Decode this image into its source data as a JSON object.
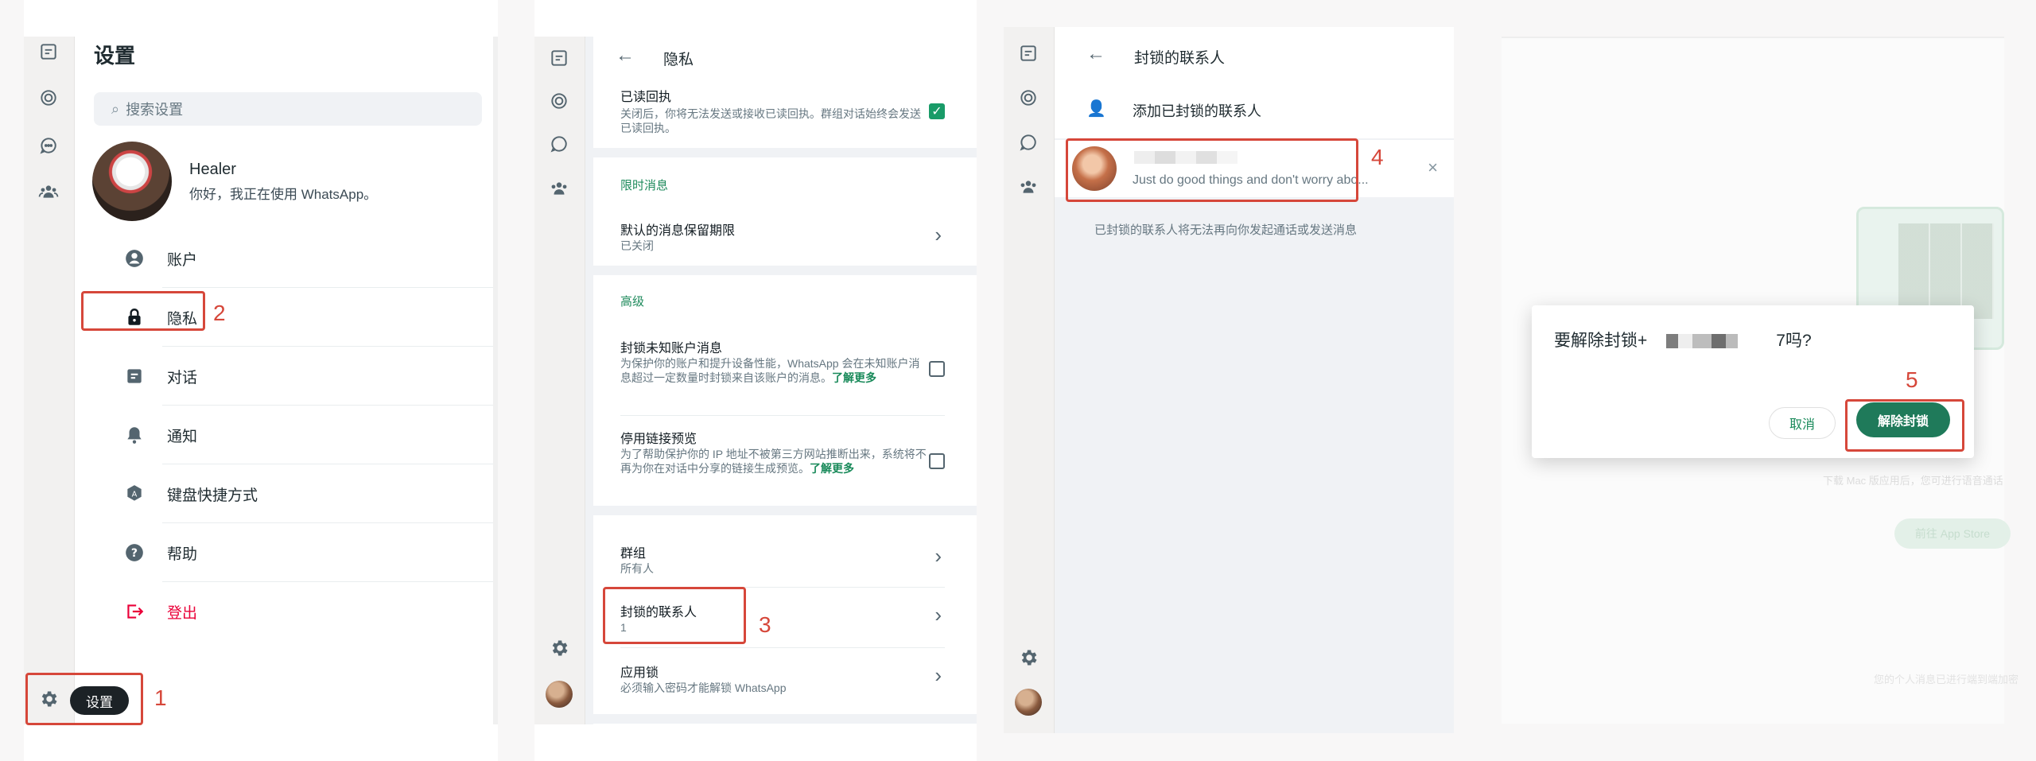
{
  "panel1": {
    "title": "设置",
    "search_placeholder": "搜索设置",
    "profile": {
      "name": "Healer",
      "status": "你好，我正在使用 WhatsApp。"
    },
    "menu": [
      {
        "label": "账户",
        "icon": "account-circle-icon"
      },
      {
        "label": "隐私",
        "icon": "lock-icon"
      },
      {
        "label": "对话",
        "icon": "chat-icon"
      },
      {
        "label": "通知",
        "icon": "bell-icon"
      },
      {
        "label": "键盘快捷方式",
        "icon": "keyboard-icon"
      },
      {
        "label": "帮助",
        "icon": "help-icon"
      },
      {
        "label": "登出",
        "icon": "logout-icon"
      }
    ],
    "settings_chip": "设置"
  },
  "panel2": {
    "title": "隐私",
    "read_receipts": {
      "title": "已读回执",
      "desc": "关闭后，你将无法发送或接收已读回执。群组对话始终会发送已读回执。"
    },
    "section_ephemeral": "限时消息",
    "default_timer": {
      "title": "默认的消息保留期限",
      "value": "已关闭"
    },
    "section_advanced": "高级",
    "block_unknown": {
      "title": "封锁未知账户消息",
      "desc": "为保护你的账户和提升设备性能，WhatsApp 会在未知账户消息超过一定数量时封锁来自该账户的消息。",
      "link": "了解更多"
    },
    "link_preview": {
      "title": "停用链接预览",
      "desc": "为了帮助保护你的 IP 地址不被第三方网站推断出来，系统将不再为你在对话中分享的链接生成预览。",
      "link": "了解更多"
    },
    "groups": {
      "title": "群组",
      "value": "所有人"
    },
    "blocked": {
      "title": "封锁的联系人",
      "value": "1"
    },
    "app_lock": {
      "title": "应用锁",
      "value": "必须输入密码才能解锁 WhatsApp"
    }
  },
  "panel3": {
    "title": "封锁的联系人",
    "add_label": "添加已封锁的联系人",
    "contact_status": "Just do good things and don't worry abo...",
    "footnote": "已封锁的联系人将无法再向你发起通话或发送消息"
  },
  "panel4": {
    "dialog_text": "要解除封锁+",
    "dialog_suffix": "7吗?",
    "cancel_label": "取消",
    "unblock_label": "解除封锁",
    "bg_button": "前往 App Store",
    "bg_text": "下载 Mac 版应用后，您可进行语音通话",
    "bg_footer": "您的个人消息已进行端到端加密"
  },
  "steps": [
    "1",
    "2",
    "3",
    "4",
    "5"
  ],
  "colors": {
    "accent_green": "#198a5a",
    "danger_red": "#d6473a",
    "logout_red": "#ea0038"
  }
}
